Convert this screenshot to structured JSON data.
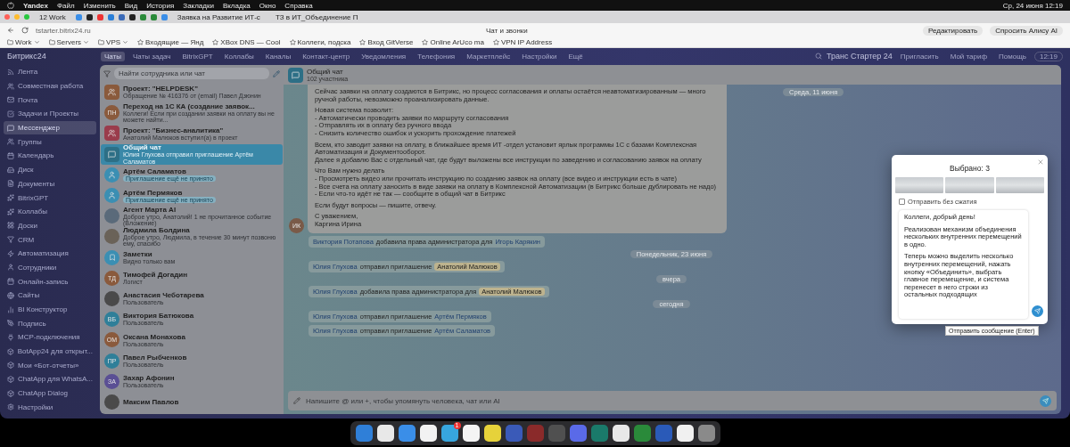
{
  "menubar": {
    "app": "Yandex",
    "items": [
      "Файл",
      "Изменить",
      "Вид",
      "История",
      "Закладки",
      "Вкладка",
      "Окно",
      "Справка"
    ],
    "clock": "Ср, 24 июня  12:19"
  },
  "browser": {
    "group": {
      "count": "12",
      "label": "Work"
    },
    "tabs": [
      {
        "label": "Заявка на Развитие ИТ-с"
      },
      {
        "label": "ТЗ в ИТ_Объединение П"
      }
    ],
    "address": "tstarter.bitrix24.ru",
    "page_title": "Чат и звонки",
    "actions": [
      "Редактировать",
      "Спросить Алису AI"
    ],
    "bookmarks": [
      {
        "label": "Work",
        "kind": "folder"
      },
      {
        "label": "Servers",
        "kind": "folder"
      },
      {
        "label": "VPS",
        "kind": "folder"
      },
      {
        "label": "Входящие — Янд",
        "kind": "link"
      },
      {
        "label": "XBox DNS — Cool",
        "kind": "link"
      },
      {
        "label": "Коллеги, подска",
        "kind": "link"
      },
      {
        "label": "Вход GitVerse",
        "kind": "link"
      },
      {
        "label": "Online ArUco ma",
        "kind": "link"
      },
      {
        "label": "VPN IP Address",
        "kind": "link"
      }
    ]
  },
  "app": {
    "logo": "Битрикс24",
    "company": "Транс Стартер 24",
    "links": [
      "Пригласить",
      "Мой тариф",
      "Помощь"
    ],
    "time": "12:19",
    "top_tabs": [
      {
        "label": "Чаты",
        "selected": true
      },
      {
        "label": "Чаты задач",
        "selected": false
      },
      {
        "label": "BitrixGPT",
        "selected": false
      },
      {
        "label": "Коллабы",
        "selected": false
      },
      {
        "label": "Каналы",
        "selected": false
      },
      {
        "label": "Контакт-центр",
        "selected": false
      },
      {
        "label": "Уведомления",
        "selected": false
      },
      {
        "label": "Телефония",
        "selected": false
      },
      {
        "label": "Маркетплейс",
        "selected": false
      },
      {
        "label": "Настройки",
        "selected": false
      },
      {
        "label": "Ещё",
        "selected": false
      }
    ]
  },
  "nav": [
    {
      "label": "Лента",
      "selected": false
    },
    {
      "label": "Совместная работа",
      "selected": false
    },
    {
      "label": "Почта",
      "selected": false
    },
    {
      "label": "Задачи и Проекты",
      "selected": false
    },
    {
      "label": "Мессенджер",
      "selected": true
    },
    {
      "label": "Группы",
      "selected": false
    },
    {
      "label": "Календарь",
      "selected": false
    },
    {
      "label": "Диск",
      "selected": false
    },
    {
      "label": "Документы",
      "selected": false
    },
    {
      "label": "BitrixGPT",
      "selected": false
    },
    {
      "label": "Коллабы",
      "selected": false
    },
    {
      "label": "Доски",
      "selected": false
    },
    {
      "label": "CRM",
      "selected": false
    },
    {
      "label": "Автоматизация",
      "selected": false
    },
    {
      "label": "Сотрудники",
      "selected": false
    },
    {
      "label": "Онлайн-запись",
      "selected": false
    },
    {
      "label": "Сайты",
      "selected": false
    },
    {
      "label": "BI Конструктор",
      "selected": false
    },
    {
      "label": "Подпись",
      "selected": false
    },
    {
      "label": "MCP-подключения",
      "selected": false
    },
    {
      "label": "BotApp24 для открыт...",
      "selected": false
    },
    {
      "label": "Мои «Бот-отчеты»",
      "selected": false
    },
    {
      "label": "ChatApp для WhatsA...",
      "selected": false
    },
    {
      "label": "ChatApp Dialog",
      "selected": false
    },
    {
      "label": "Настройки",
      "selected": false
    }
  ],
  "chat_search": {
    "placeholder": "Найти сотрудника или чат"
  },
  "chats": [
    {
      "name": "Проект: \"HELPDESK\"",
      "preview": "Обращение № 416376 от (email) Павел Дзюнин",
      "avatar": {
        "kind": "group",
        "color": "#8a5a3c"
      },
      "selected": false
    },
    {
      "name": "Переход на 1С КА (создание заявок...",
      "preview": "Коллеги! Если при создании заявки на оплату вы не можете найти...",
      "avatar": {
        "kind": "initials",
        "text": "ПН",
        "color": "#8a5a3c"
      },
      "selected": false
    },
    {
      "name": "Проект: \"Бизнес-аналитика\"",
      "preview": "Анатолий Малюков вступил(а) в проект",
      "avatar": {
        "kind": "group",
        "color": "#9a3c4c"
      },
      "selected": false
    },
    {
      "name": "Общий чат",
      "preview": "Юлия Глухова отправил приглашение Артём Саламатов",
      "avatar": {
        "kind": "chat",
        "color": "#2d6f86"
      },
      "selected": true
    },
    {
      "name": "Артём Саламатов",
      "tag": "Приглашение ещё не принято",
      "avatar": {
        "kind": "invite",
        "color": "#3b8fb3"
      },
      "selected": false
    },
    {
      "name": "Артём Пермяков",
      "tag": "Приглашение ещё не принято",
      "avatar": {
        "kind": "invite",
        "color": "#3b8fb3"
      },
      "selected": false
    },
    {
      "name": "Агент Марта AI",
      "preview": "Доброе утро, Анатолий! 1 не прочитанное событие (Вложение)",
      "avatar": {
        "kind": "photo",
        "color": "#5a6a7a"
      },
      "selected": false
    },
    {
      "name": "Людмила Болдина",
      "preview": "Доброе утро, Людмила, в течение 30 минут позвоню ему, спасибо",
      "avatar": {
        "kind": "photo",
        "color": "#6a6258"
      },
      "selected": false
    },
    {
      "name": "Заметки",
      "preview": "Видно только вам",
      "avatar": {
        "kind": "bookmark",
        "color": "#3b8fb3"
      },
      "selected": false
    },
    {
      "name": "Тимофей Догадин",
      "preview": "Логист",
      "avatar": {
        "kind": "initials",
        "text": "ТД",
        "color": "#8a5a3c"
      },
      "selected": false
    },
    {
      "name": "Анастасия Чеботарева",
      "preview": "Пользователь",
      "avatar": {
        "kind": "photo",
        "color": "#4a4a4a"
      },
      "selected": false
    },
    {
      "name": "Виктория Батюкова",
      "preview": "Пользователь",
      "avatar": {
        "kind": "initials",
        "text": "ВБ",
        "color": "#2f7f99"
      },
      "selected": false
    },
    {
      "name": "Оксана Монахова",
      "preview": "Пользователь",
      "avatar": {
        "kind": "initials",
        "text": "ОМ",
        "color": "#8a5a3c"
      },
      "selected": false
    },
    {
      "name": "Павел Рыбченков",
      "preview": "Пользователь",
      "avatar": {
        "kind": "initials",
        "text": "ПР",
        "color": "#2f7f99"
      },
      "selected": false
    },
    {
      "name": "Захар Афонин",
      "preview": "Пользователь",
      "avatar": {
        "kind": "initials",
        "text": "ЗА",
        "color": "#5a4f94"
      },
      "selected": false
    },
    {
      "name": "Максим Павлов",
      "avatar": {
        "kind": "photo",
        "color": "#4a4a4a"
      },
      "selected": false
    }
  ],
  "chat": {
    "title": "Общий чат",
    "subtitle": "102 участника",
    "sticky_date": "Среда, 11 июня",
    "message": {
      "author_initials": "ИК",
      "paragraphs": [
        "Сейчас заявки на оплату создаются в Битрикс, но процесс согласования и оплаты остаётся неавтоматизированным — много ручной работы, невозможно проанализировать данные.",
        "Новая система позволит:\n-    Автоматически проводить заявки по маршруту согласования\n-    Отправлять их в оплату без ручного ввода\n-    Снизить количество ошибок и ускорить прохождение платежей",
        "Всем, кто заводит заявки на оплату, в ближайшее время ИТ -отдел установит ярлык программы 1С с базами Комплексная Автоматизация и Документооборот.\nДалее я добавлю Вас с отдельный чат, где будут выложены все инструкции по заведению и согласованию заявок на оплату",
        "Что Вам нужно делать\n-    Просмотреть видео или прочитать инструкцию по созданию заявок на оплату (все видео и инструкции есть в чате)\n-    Все счета на оплату заносить в виде заявки на оплату в Комплексной Автоматизации (в Битрикс больше дублировать не надо)\n-    Если что-то идёт не так — сообщите в общий чат в Битрикс",
        "Если будут вопросы — пишите, отвечу.",
        "С уважением,\nКаргина Ирина"
      ]
    },
    "events": [
      {
        "kind": "system",
        "actor": "Виктория Потапова",
        "action": "добавила права администратора для",
        "target": "Игорь Карякин"
      },
      {
        "kind": "date",
        "label": "Понедельник, 23 июня"
      },
      {
        "kind": "system_mention",
        "actor": "Юлия Глухова",
        "action": "отправил приглашение",
        "target": "Анатолий Малюков"
      },
      {
        "kind": "date",
        "label": "вчера"
      },
      {
        "kind": "system_mention",
        "actor": "Юлия Глухова",
        "action": "добавила права администратора для",
        "target": "Анатолий Малюков"
      },
      {
        "kind": "date",
        "label": "сегодня"
      },
      {
        "kind": "system",
        "actor": "Юлия Глухова",
        "action": "отправил приглашение",
        "target": "Артём Пермяков"
      },
      {
        "kind": "system",
        "actor": "Юлия Глухова",
        "action": "отправил приглашение",
        "target": "Артём Саламатов"
      }
    ],
    "composer": {
      "placeholder": "Напишите @ или +, чтобы упомянуть человека, чат или AI"
    }
  },
  "modal": {
    "title": "Выбрано: 3",
    "no_compress": {
      "label": "Отправить без сжатия",
      "checked": false
    },
    "text": [
      "Коллеги, добрый день!",
      "Реализован механизм объединения нескольких внутренних перемещений в одно.",
      "Теперь можно выделить несколько внутренних перемещений, нажать кнопку «Объединить», выбрать главное перемещение, и система перенесет в него строки из остальных подходящих"
    ],
    "tooltip": "Отправить сообщение (Enter)"
  },
  "dock": [
    {
      "color": "#2f7fd8"
    },
    {
      "color": "#e8e8e8"
    },
    {
      "color": "#3a8ee8"
    },
    {
      "color": "#f2f2f2"
    },
    {
      "color": "#37a6de",
      "badge": "1"
    },
    {
      "color": "#f4f4f4"
    },
    {
      "color": "#e6d23a"
    },
    {
      "color": "#3a5ab8"
    },
    {
      "color": "#8a2a2a"
    },
    {
      "color": "#505050"
    },
    {
      "color": "#5a6ae8"
    },
    {
      "color": "#1a7a6a"
    },
    {
      "color": "#e8e8e8"
    },
    {
      "color": "#2a8a3a"
    },
    {
      "color": "#2a5ab8"
    },
    {
      "color": "#f0f0f0"
    },
    {
      "color": "#8a8a8a"
    }
  ]
}
